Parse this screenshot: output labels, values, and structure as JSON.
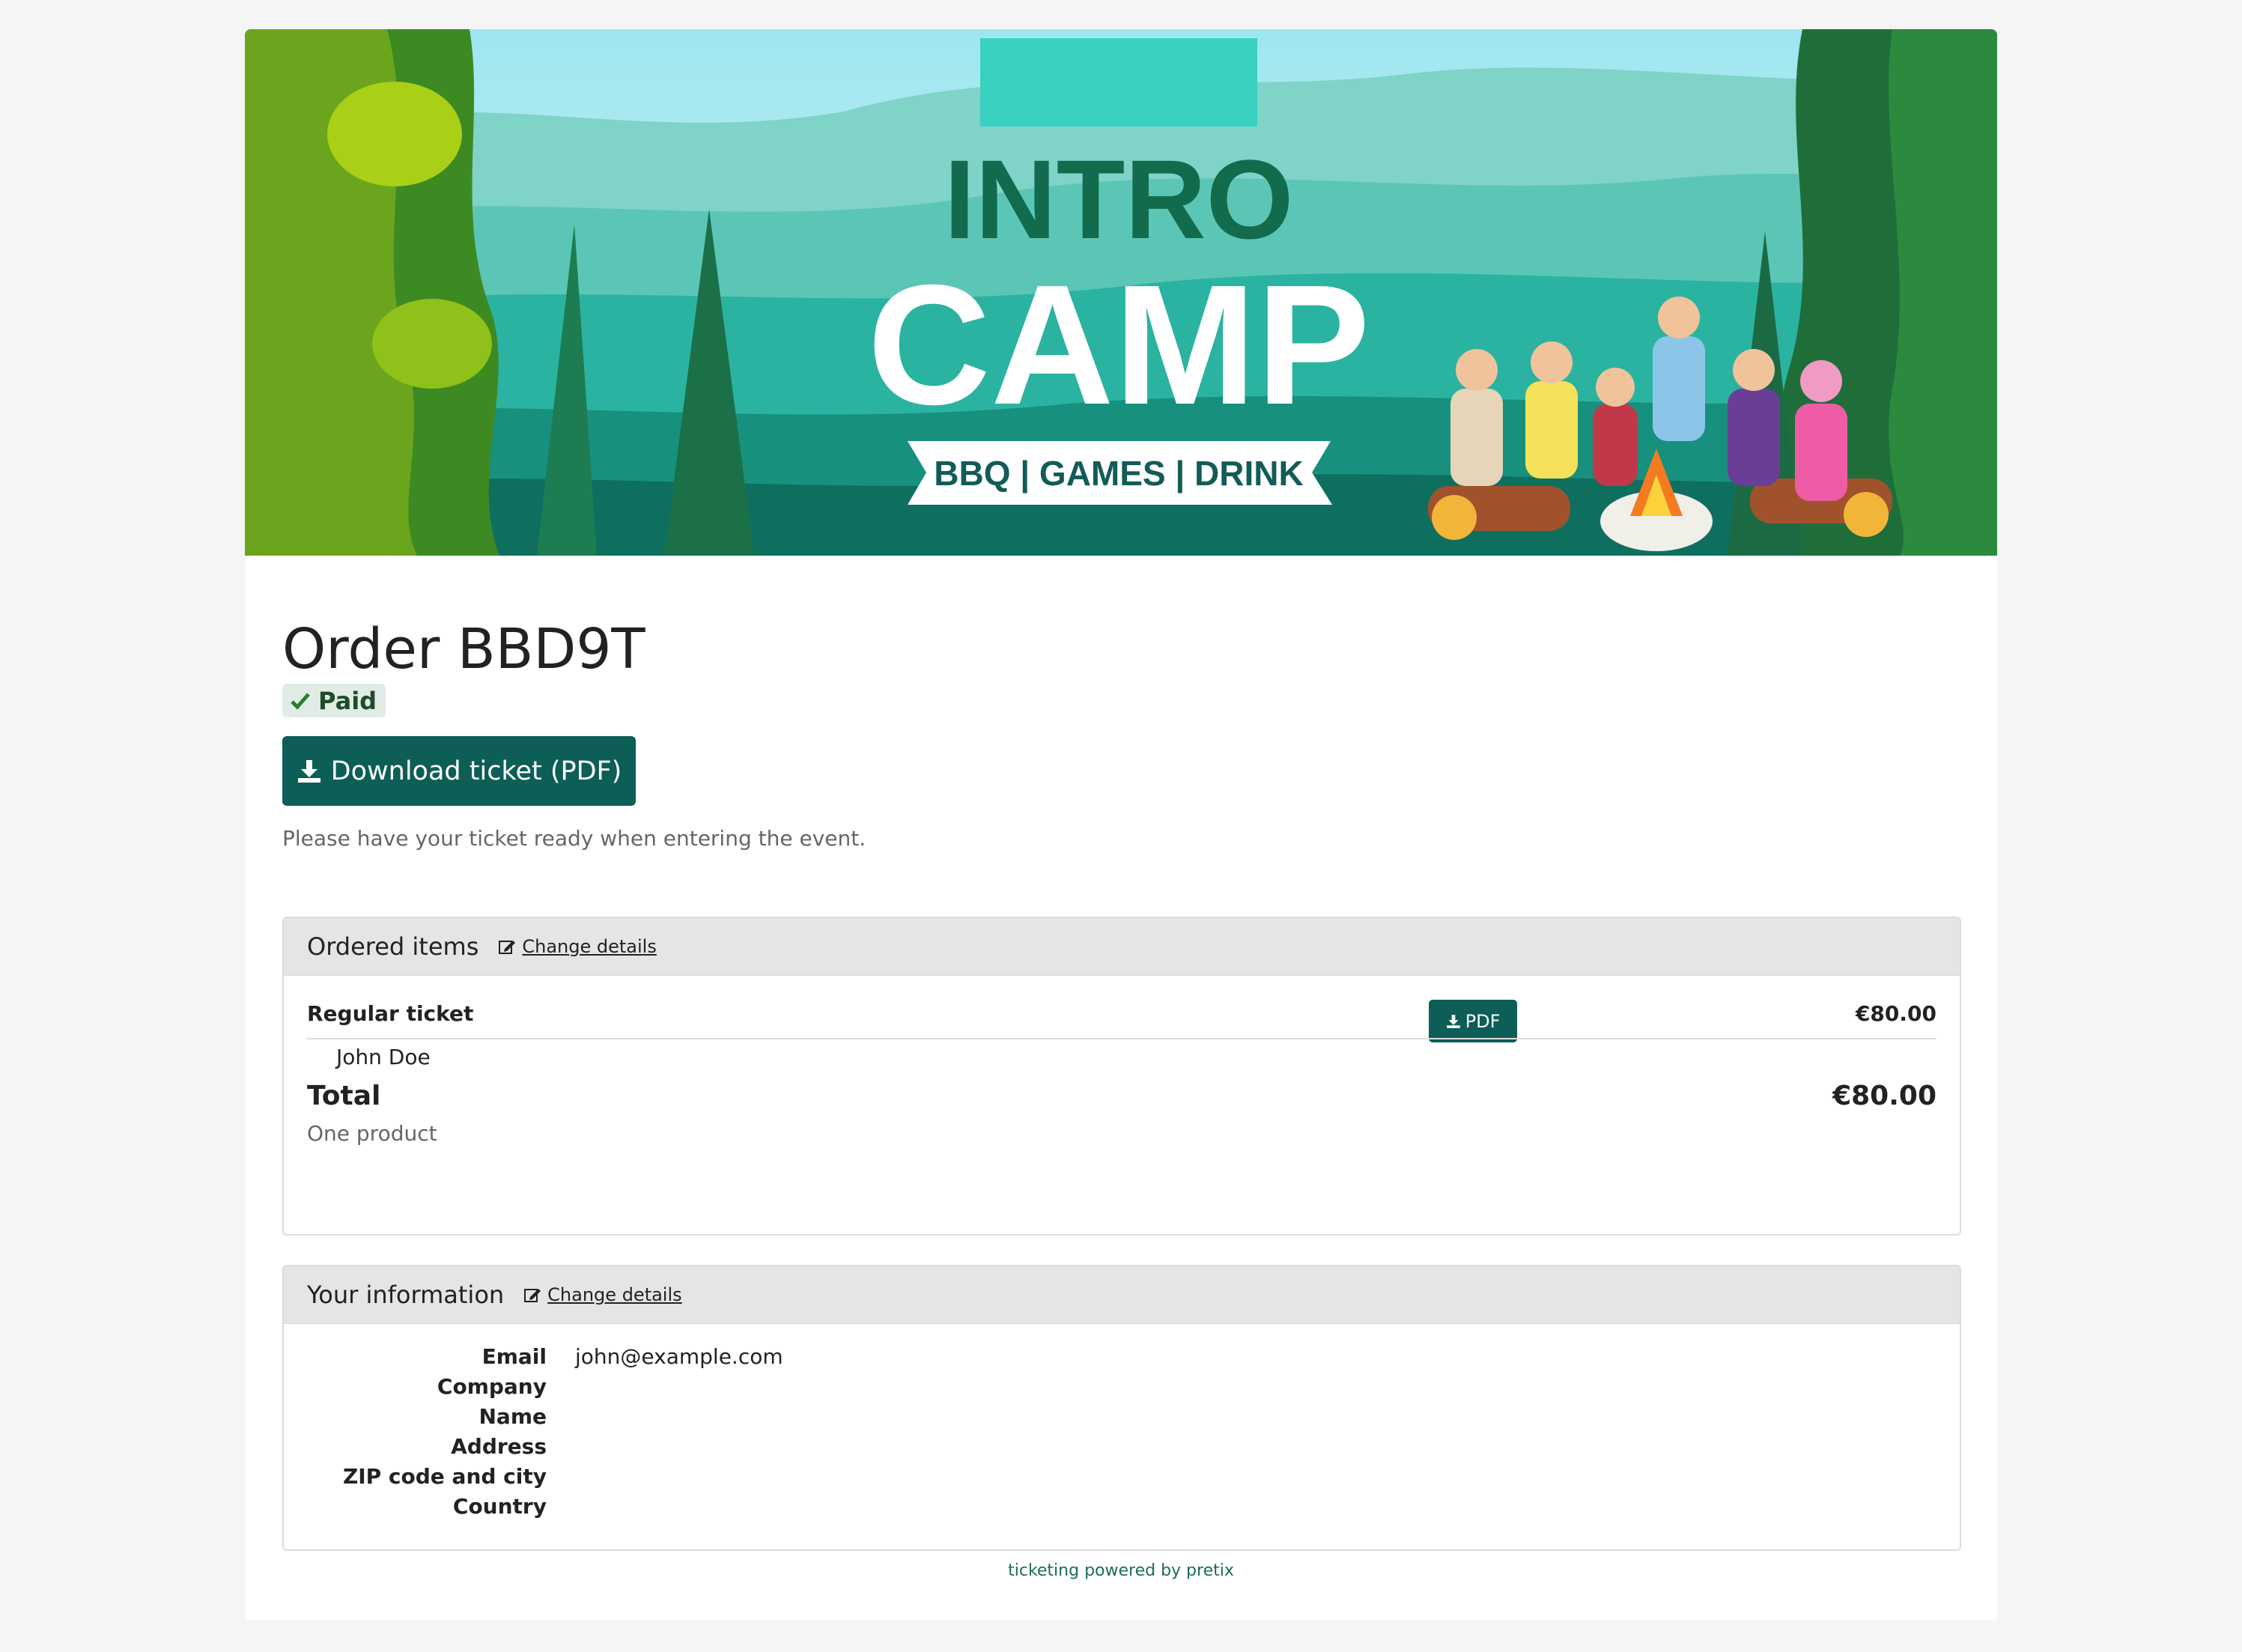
{
  "banner": {
    "line1": "INTRO",
    "line2": "CAMP",
    "ribbon": "BBQ | GAMES | DRINK"
  },
  "order": {
    "title": "Order BBD9T",
    "status": "Paid",
    "download_label": "Download ticket (PDF)",
    "hint": "Please have your ticket ready when entering the event."
  },
  "items_panel": {
    "title": "Ordered items",
    "change_label": "Change details",
    "item": {
      "name": "Regular ticket",
      "attendee": "John Doe",
      "pdf_label": "PDF",
      "price": "€80.00"
    },
    "total_label": "Total",
    "total_sub": "One product",
    "total_value": "€80.00"
  },
  "info_panel": {
    "title": "Your information",
    "change_label": "Change details",
    "rows": [
      {
        "label": "Email",
        "value": "john@example.com"
      },
      {
        "label": "Company",
        "value": ""
      },
      {
        "label": "Name",
        "value": ""
      },
      {
        "label": "Address",
        "value": ""
      },
      {
        "label": "ZIP code and city",
        "value": ""
      },
      {
        "label": "Country",
        "value": ""
      }
    ]
  },
  "footer": "ticketing powered by pretix",
  "colors": {
    "primary": "#0d5e56",
    "paid_bg": "#e2ece6",
    "paid_text": "#1d4d2a",
    "page_bg": "#f5f5f5"
  }
}
